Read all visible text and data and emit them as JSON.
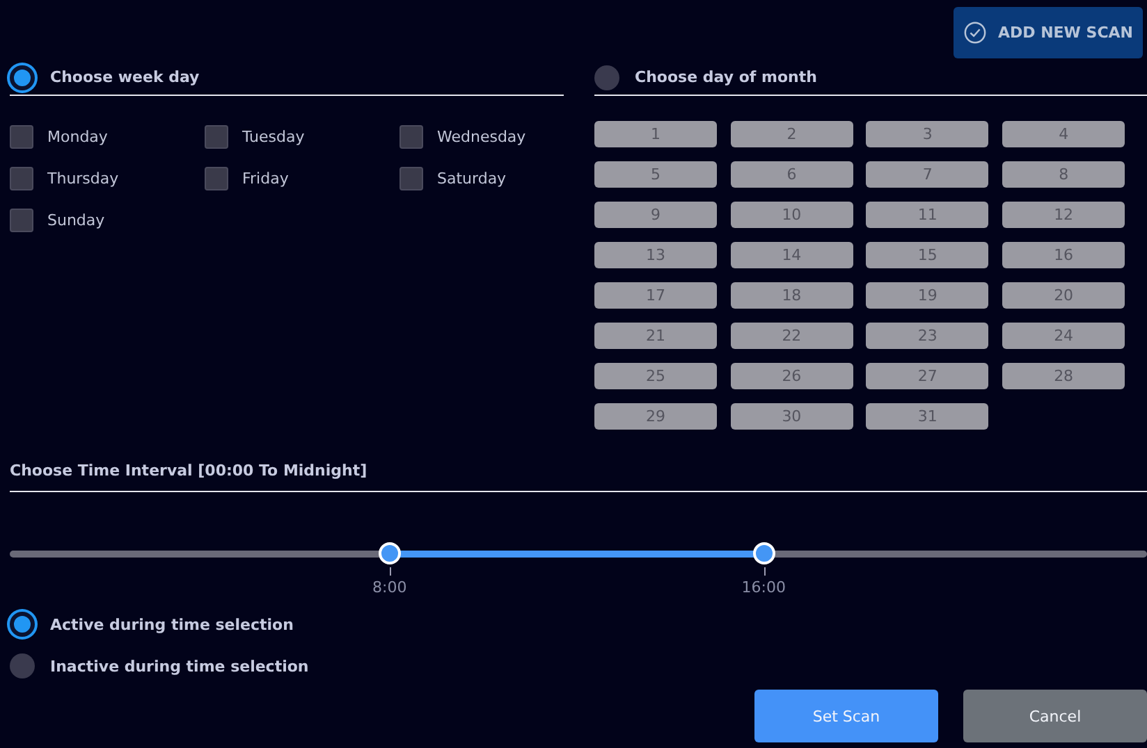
{
  "add_button": {
    "label": "ADD NEW SCAN"
  },
  "week_section": {
    "title": "Choose week day",
    "selected": true,
    "days": [
      {
        "label": "Monday",
        "checked": false
      },
      {
        "label": "Tuesday",
        "checked": false
      },
      {
        "label": "Wednesday",
        "checked": false
      },
      {
        "label": "Thursday",
        "checked": false
      },
      {
        "label": "Friday",
        "checked": false
      },
      {
        "label": "Saturday",
        "checked": false
      },
      {
        "label": "Sunday",
        "checked": false
      }
    ]
  },
  "month_section": {
    "title": "Choose day of month",
    "selected": false,
    "disabled": true,
    "days": [
      "1",
      "2",
      "3",
      "4",
      "5",
      "6",
      "7",
      "8",
      "9",
      "10",
      "11",
      "12",
      "13",
      "14",
      "15",
      "16",
      "17",
      "18",
      "19",
      "20",
      "21",
      "22",
      "23",
      "24",
      "25",
      "26",
      "27",
      "28",
      "29",
      "30",
      "31"
    ]
  },
  "time_section": {
    "title": "Choose Time Interval [00:00 To Midnight]",
    "thumbs": [
      {
        "level": 0.334,
        "label": "8:00"
      },
      {
        "level": 0.663,
        "label": "16:00"
      }
    ],
    "modes": [
      {
        "label": "Active during time selection",
        "selected": true
      },
      {
        "label": "Inactive during time selection",
        "selected": false
      }
    ]
  },
  "buttons": [
    {
      "label": "Set Scan",
      "kind": "primary"
    },
    {
      "label": "Cancel",
      "kind": "secondary"
    }
  ]
}
